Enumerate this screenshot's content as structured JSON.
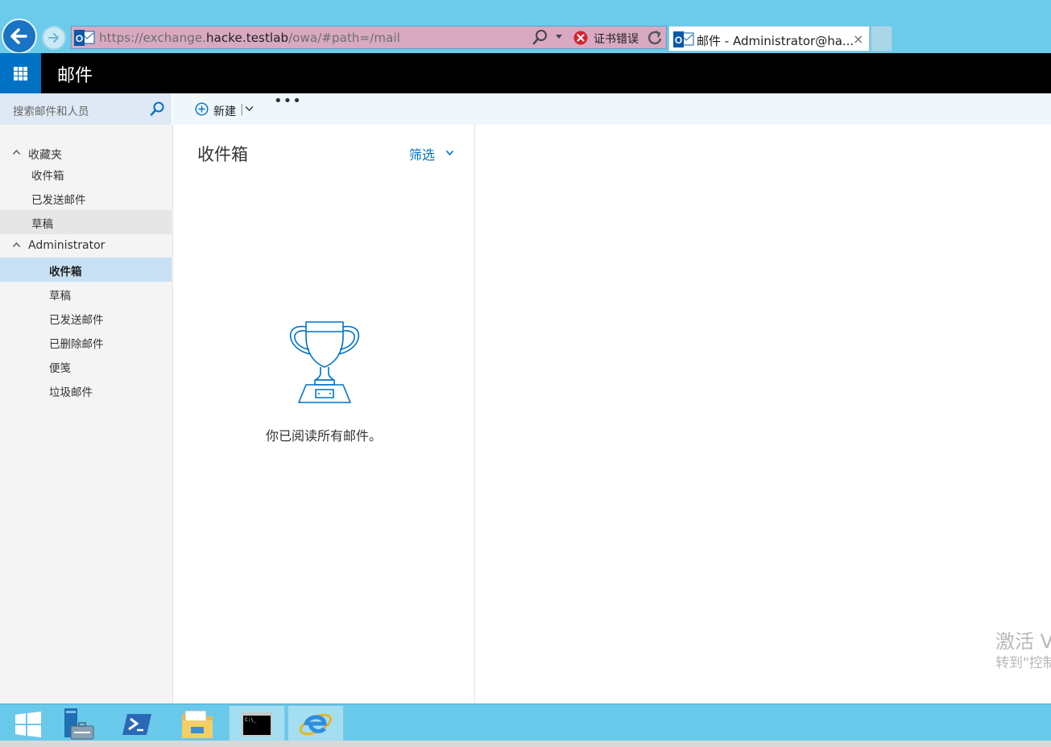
{
  "browser": {
    "url_prefix": "https://exchange.",
    "url_host": "hacke.testlab",
    "url_path": "/owa/#path=/mail",
    "cert_error": "证书错误",
    "tab_title": "邮件 - Administrator@ha...",
    "tab_close": "×"
  },
  "header": {
    "app_title": "邮件"
  },
  "search": {
    "placeholder": "搜索邮件和人员"
  },
  "toolbar": {
    "new_label": "新建",
    "separator": "|",
    "more": "•••"
  },
  "nav": {
    "favorites": {
      "label": "收藏夹",
      "items": [
        "收件箱",
        "已发送邮件",
        "草稿"
      ]
    },
    "account": {
      "label": "Administrator",
      "items": [
        "收件箱",
        "草稿",
        "已发送邮件",
        "已删除邮件",
        "便笺",
        "垃圾邮件"
      ]
    }
  },
  "message_list": {
    "folder_title": "收件箱",
    "filter_label": "筛选",
    "empty_text": "你已阅读所有邮件。"
  },
  "watermark": {
    "line1": "激活 V",
    "line2": "转到\"控制"
  },
  "colors": {
    "accent": "#0072c6",
    "header_bg": "#000000",
    "selected_bg": "#c7e0f4",
    "taskbar_bg": "#69c9ea"
  },
  "icons": {
    "back": "back-arrow-icon",
    "forward": "forward-arrow-icon",
    "search": "search-icon",
    "new": "plus-circle-icon",
    "filter_chevron": "chevron-down-icon",
    "empty_state": "trophy-icon",
    "taskbar": [
      "windows-start-icon",
      "server-manager-icon",
      "powershell-icon",
      "file-explorer-icon",
      "command-prompt-icon",
      "internet-explorer-icon"
    ]
  }
}
